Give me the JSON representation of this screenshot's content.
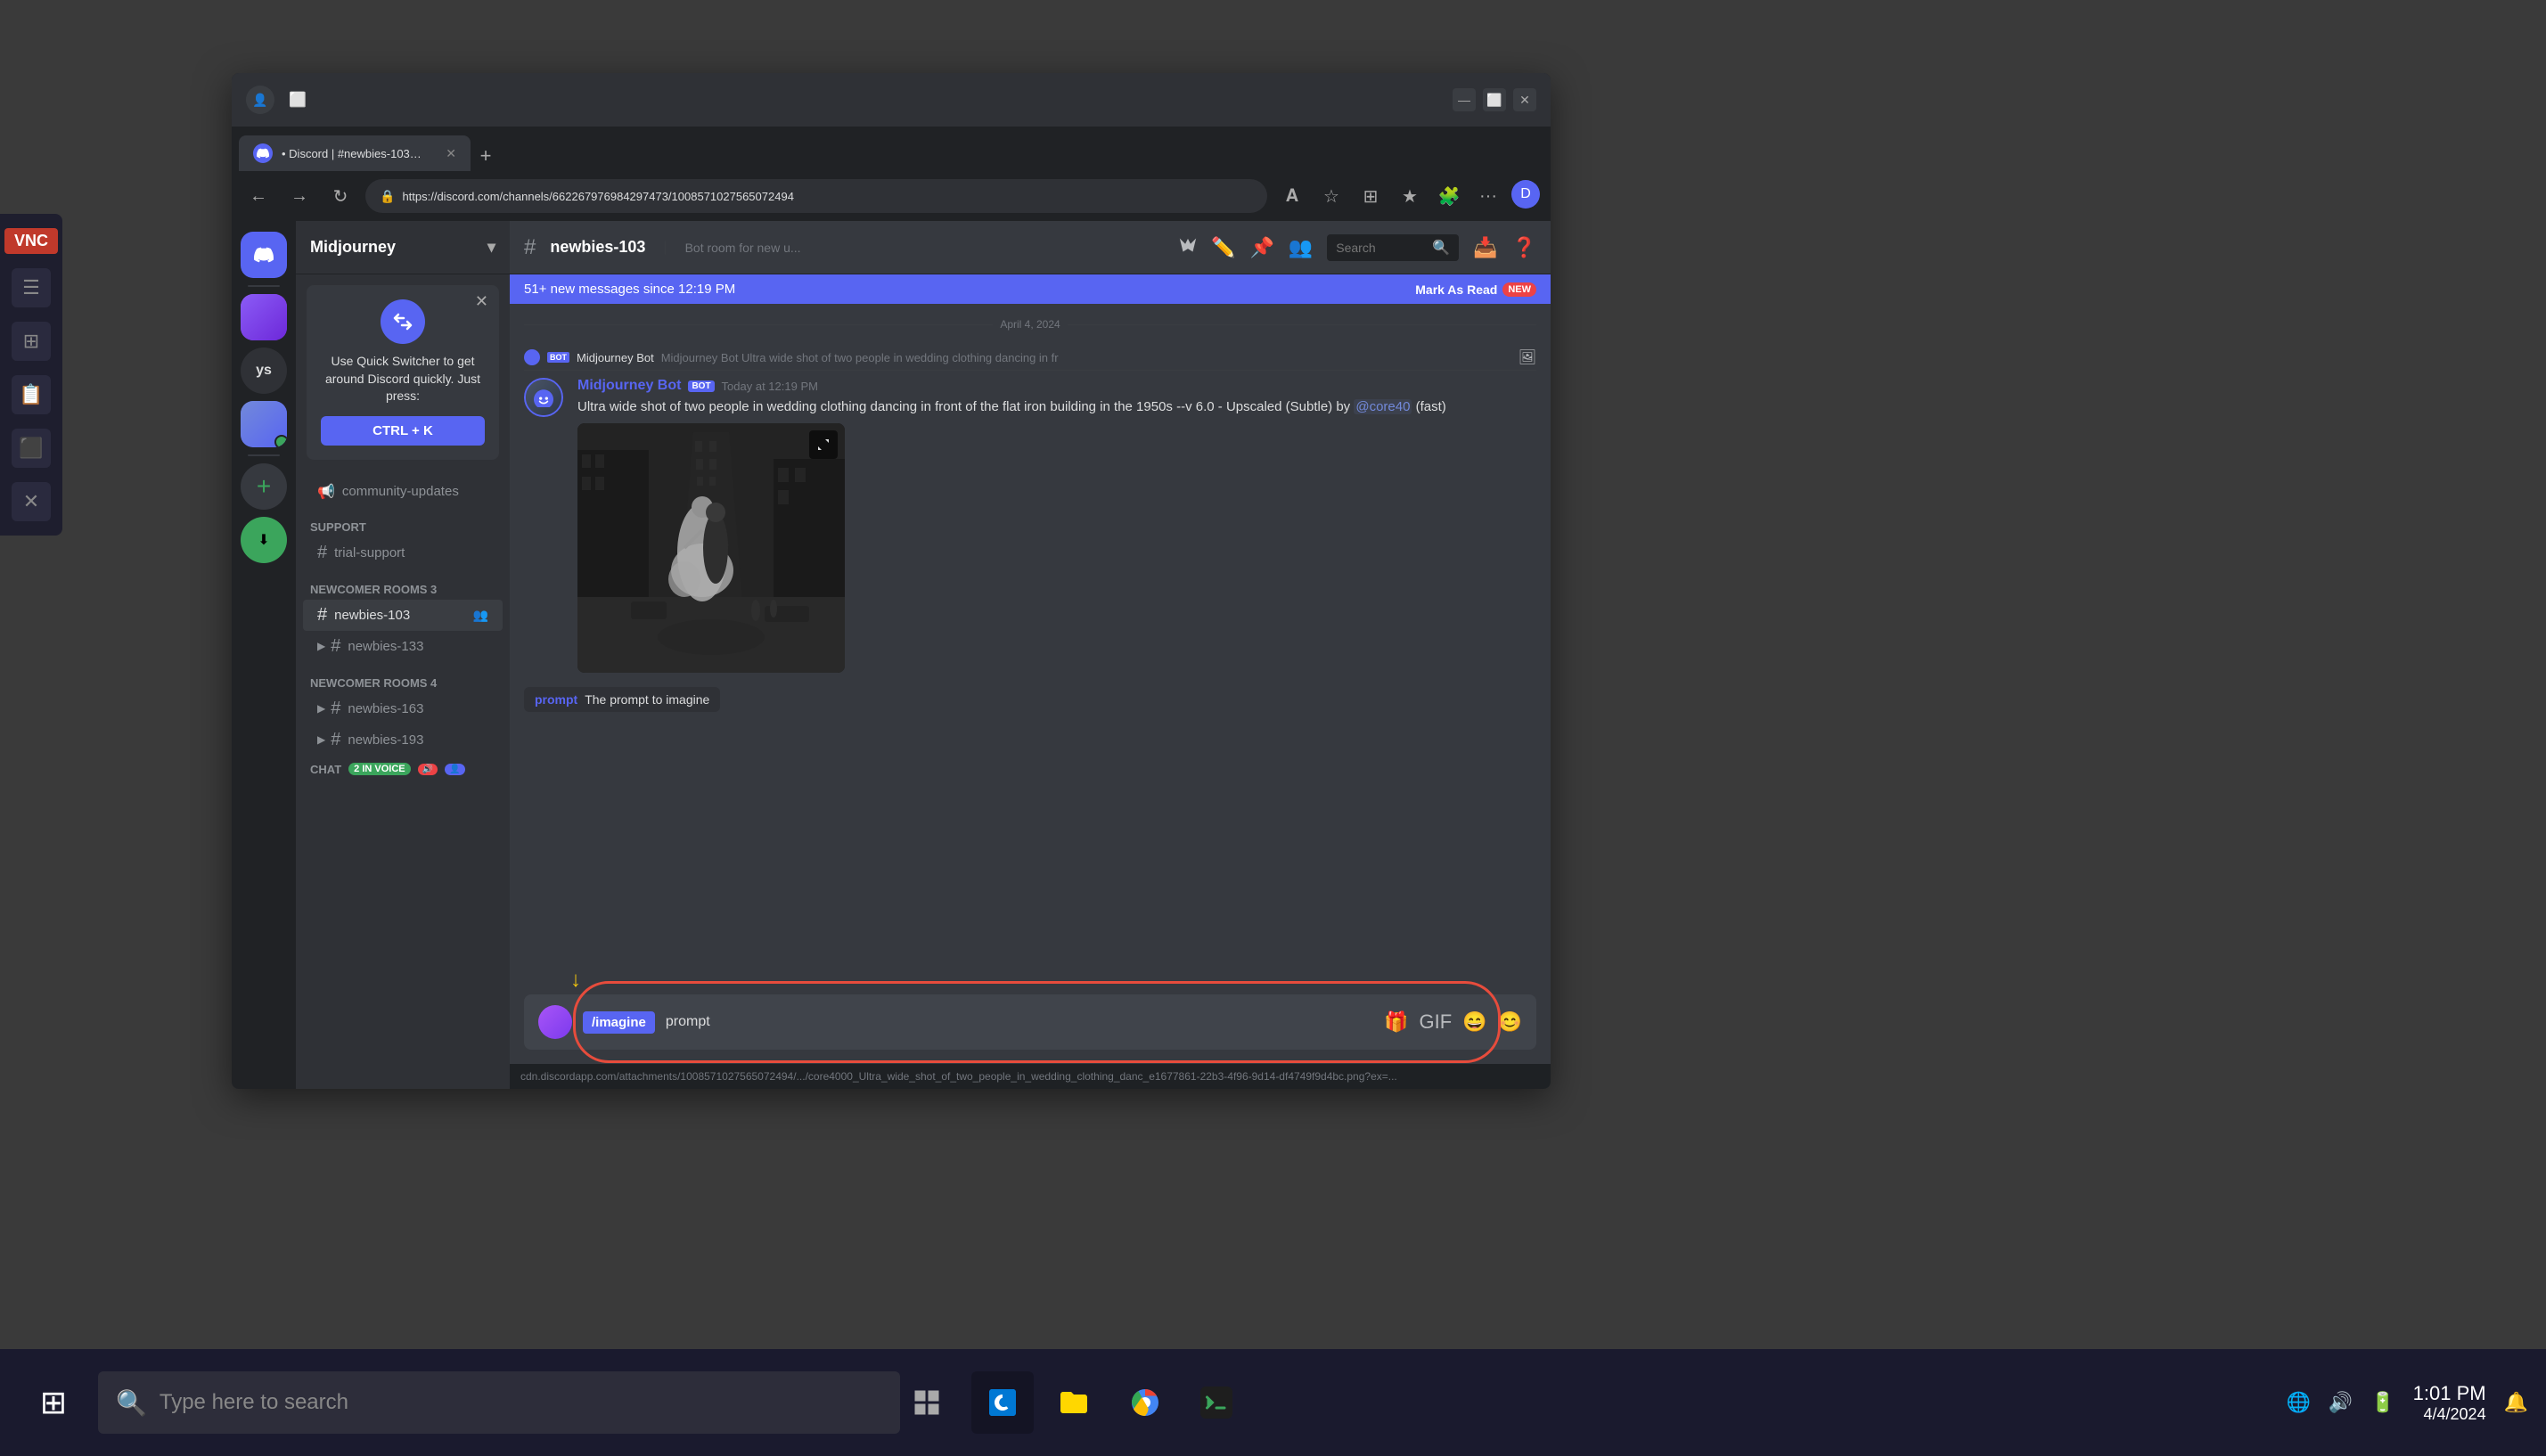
{
  "desktop": {
    "background_color": "#3a3a3a"
  },
  "taskbar": {
    "search_placeholder": "Type here to search",
    "time": "1:01 PM",
    "date": "4/4/2024",
    "apps": [
      "⊞",
      "🌐",
      "📁",
      "🔵",
      "🖥️"
    ]
  },
  "vnc": {
    "label": "VNC",
    "icons": [
      "☰",
      "⊞",
      "📋",
      "⬛",
      "✕"
    ]
  },
  "browser": {
    "title": "Discord | #newbies-103 | Midj...",
    "url": "https://discord.com/channels/662267976984297473/1008571027565072494",
    "tab_label": "• Discord | #newbies-103 | Midj...",
    "new_tab": "+"
  },
  "discord": {
    "server_name": "Midjourney",
    "channel_name": "newbies-103",
    "channel_desc": "Bot room for new u...",
    "new_messages_banner": "51+ new messages since 12:19 PM",
    "mark_as_read": "Mark As Read",
    "search_placeholder": "Search",
    "categories": {
      "support": "SUPPORT",
      "newcomer3": "NEWCOMER ROOMS 3",
      "newcomer4": "NEWCOMER ROOMS 4",
      "chat": "CHAT"
    },
    "channels": [
      {
        "name": "community-updates",
        "type": "announcement"
      },
      {
        "name": "trial-support",
        "type": "text"
      },
      {
        "name": "newbies-103",
        "type": "text",
        "active": true
      },
      {
        "name": "newbies-133",
        "type": "text"
      },
      {
        "name": "newbies-163",
        "type": "text"
      },
      {
        "name": "newbies-193",
        "type": "text"
      }
    ],
    "voice_badge": "2 IN VOICE",
    "quick_switcher": {
      "title": "Use Quick Switcher to get around Discord quickly. Just press:",
      "shortcut": "CTRL + K"
    },
    "message": {
      "author": "Midjourney Bot",
      "is_bot": true,
      "time": "Today at 12:19 PM",
      "text": "Ultra wide shot of two people in wedding clothing dancing in front of the flat iron building in the 1950s --v 6.0",
      "upscale_info": "- Upscaled (Subtle) by",
      "mention": "@core40",
      "speed": "(fast)",
      "preview_text": "Midjourney Bot  Ultra wide shot of two people in wedding clothing dancing in fr"
    },
    "prompt_hint": {
      "label": "prompt",
      "text": "The prompt to imagine"
    },
    "chat_input": {
      "command": "/imagine",
      "value": "prompt",
      "cursor": true
    },
    "status_bar": "cdn.discordapp.com/attachments/1008571027565072494/.../core4000_Ultra_wide_shot_of_two_people_in_wedding_clothing_danc_e1677861-22b3-4f96-9d14-df4749f9d4bc.png?ex=..."
  }
}
